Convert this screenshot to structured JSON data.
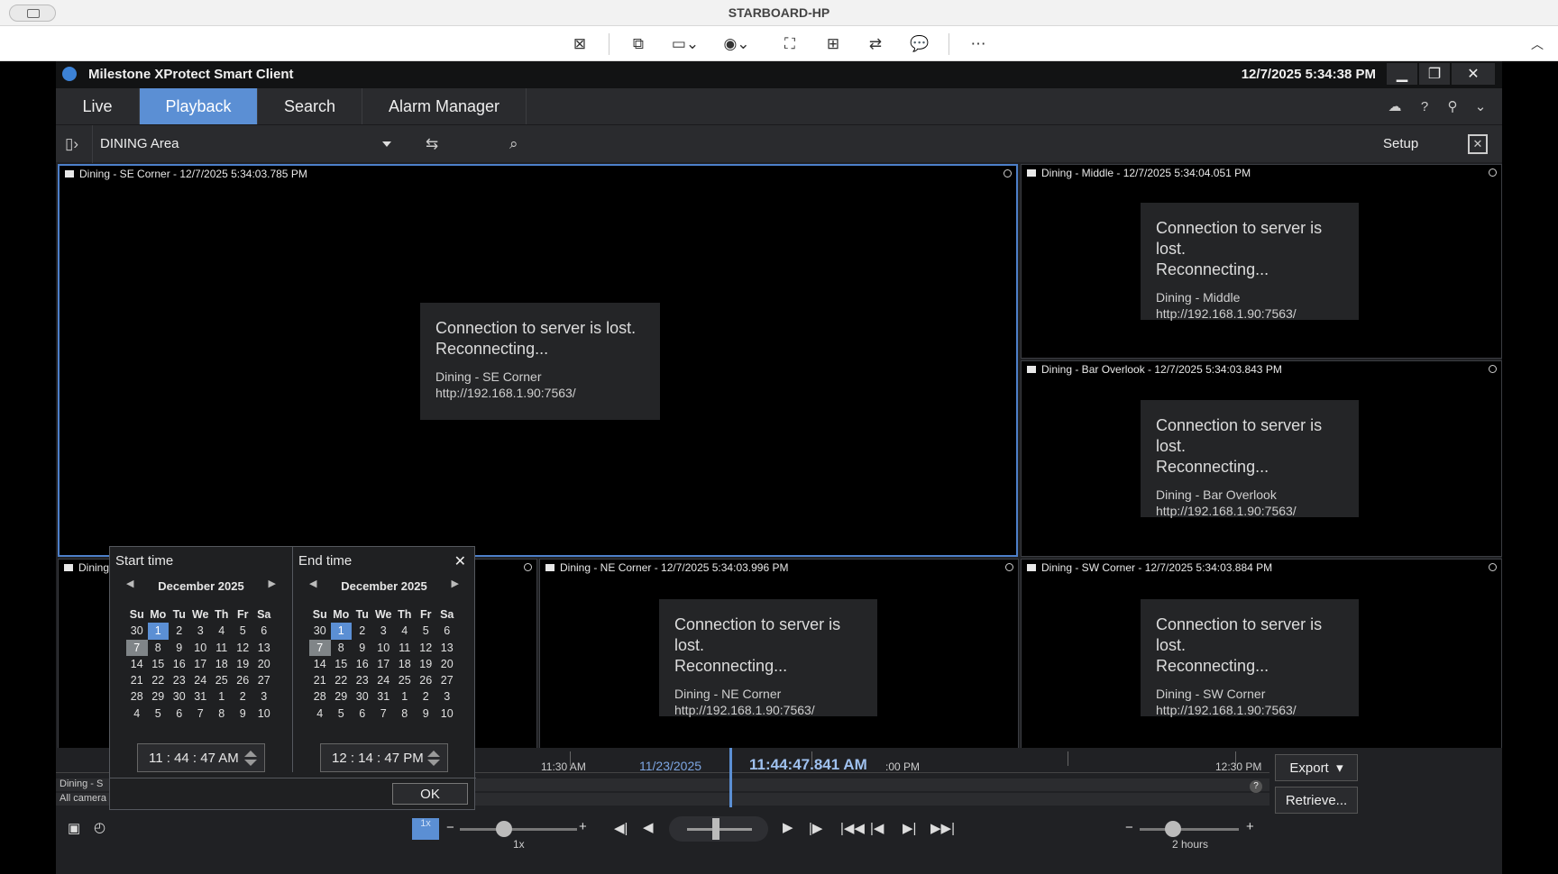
{
  "remote": {
    "host": "STARBOARD-HP"
  },
  "app": {
    "title": "Milestone XProtect Smart Client",
    "datetime": "12/7/2025 5:34:38 PM",
    "tabs": [
      "Live",
      "Playback",
      "Search",
      "Alarm Manager"
    ],
    "active_tab": "Playback"
  },
  "viewbar": {
    "view_name": "DINING Area",
    "setup_label": "Setup"
  },
  "cameras": [
    {
      "name": "Dining - SE Corner - 12/7/2025 5:34:03.785 PM",
      "msg1": "Connection to server is lost.",
      "msg2": "Reconnecting...",
      "cam": "Dining - SE Corner",
      "url": "http://192.168.1.90:7563/"
    },
    {
      "name": "Dining - Middle - 12/7/2025 5:34:04.051 PM",
      "msg1": "Connection to server is lost.",
      "msg2": "Reconnecting...",
      "cam": "Dining - Middle",
      "url": "http://192.168.1.90:7563/"
    },
    {
      "name": "Dining - Bar Overlook - 12/7/2025 5:34:03.843 PM",
      "msg1": "Connection to server is lost.",
      "msg2": "Reconnecting...",
      "cam": "Dining - Bar Overlook",
      "url": "http://192.168.1.90:7563/"
    },
    {
      "name": "Dining",
      "msg1": "",
      "msg2": "",
      "cam": "",
      "url": ""
    },
    {
      "name": "Dining - NE Corner - 12/7/2025 5:34:03.996 PM",
      "msg1": "Connection to server is lost.",
      "msg2": "Reconnecting...",
      "cam": "Dining - NE Corner",
      "url": "http://192.168.1.90:7563/"
    },
    {
      "name": "Dining - SW Corner - 12/7/2025 5:34:03.884 PM",
      "msg1": "Connection to server is lost.",
      "msg2": "Reconnecting...",
      "cam": "Dining - SW Corner",
      "url": "http://192.168.1.90:7563/"
    }
  ],
  "timeline": {
    "labels": [
      "11:30 AM",
      ":00 PM",
      "12:30 PM"
    ],
    "date": "11/23/2025",
    "current": "11:44:47.841 AM",
    "row1": "Dining - S",
    "row2": "All camera",
    "help": "?",
    "export_label": "Export",
    "retrieve_label": "Retrieve...",
    "speed_label": "1x",
    "speed_badge": "1x",
    "span_label": "2 hours"
  },
  "dialog": {
    "start_title": "Start time",
    "end_title": "End time",
    "start_month": "December 2025",
    "end_month": "December 2025",
    "dow": [
      "Su",
      "Mo",
      "Tu",
      "We",
      "Th",
      "Fr",
      "Sa"
    ],
    "weeks": [
      [
        "30",
        "1",
        "2",
        "3",
        "4",
        "5",
        "6"
      ],
      [
        "7",
        "8",
        "9",
        "10",
        "11",
        "12",
        "13"
      ],
      [
        "14",
        "15",
        "16",
        "17",
        "18",
        "19",
        "20"
      ],
      [
        "21",
        "22",
        "23",
        "24",
        "25",
        "26",
        "27"
      ],
      [
        "28",
        "29",
        "30",
        "31",
        "1",
        "2",
        "3"
      ],
      [
        "4",
        "5",
        "6",
        "7",
        "8",
        "9",
        "10"
      ]
    ],
    "start_time": "11 : 44 : 47  AM",
    "end_time": "12 : 14 : 47  PM",
    "ok_label": "OK",
    "close_glyph": "✕"
  },
  "colors": {
    "accent": "#5b8fd4",
    "selected_day": "#5b8fd4",
    "today": "#808588"
  }
}
